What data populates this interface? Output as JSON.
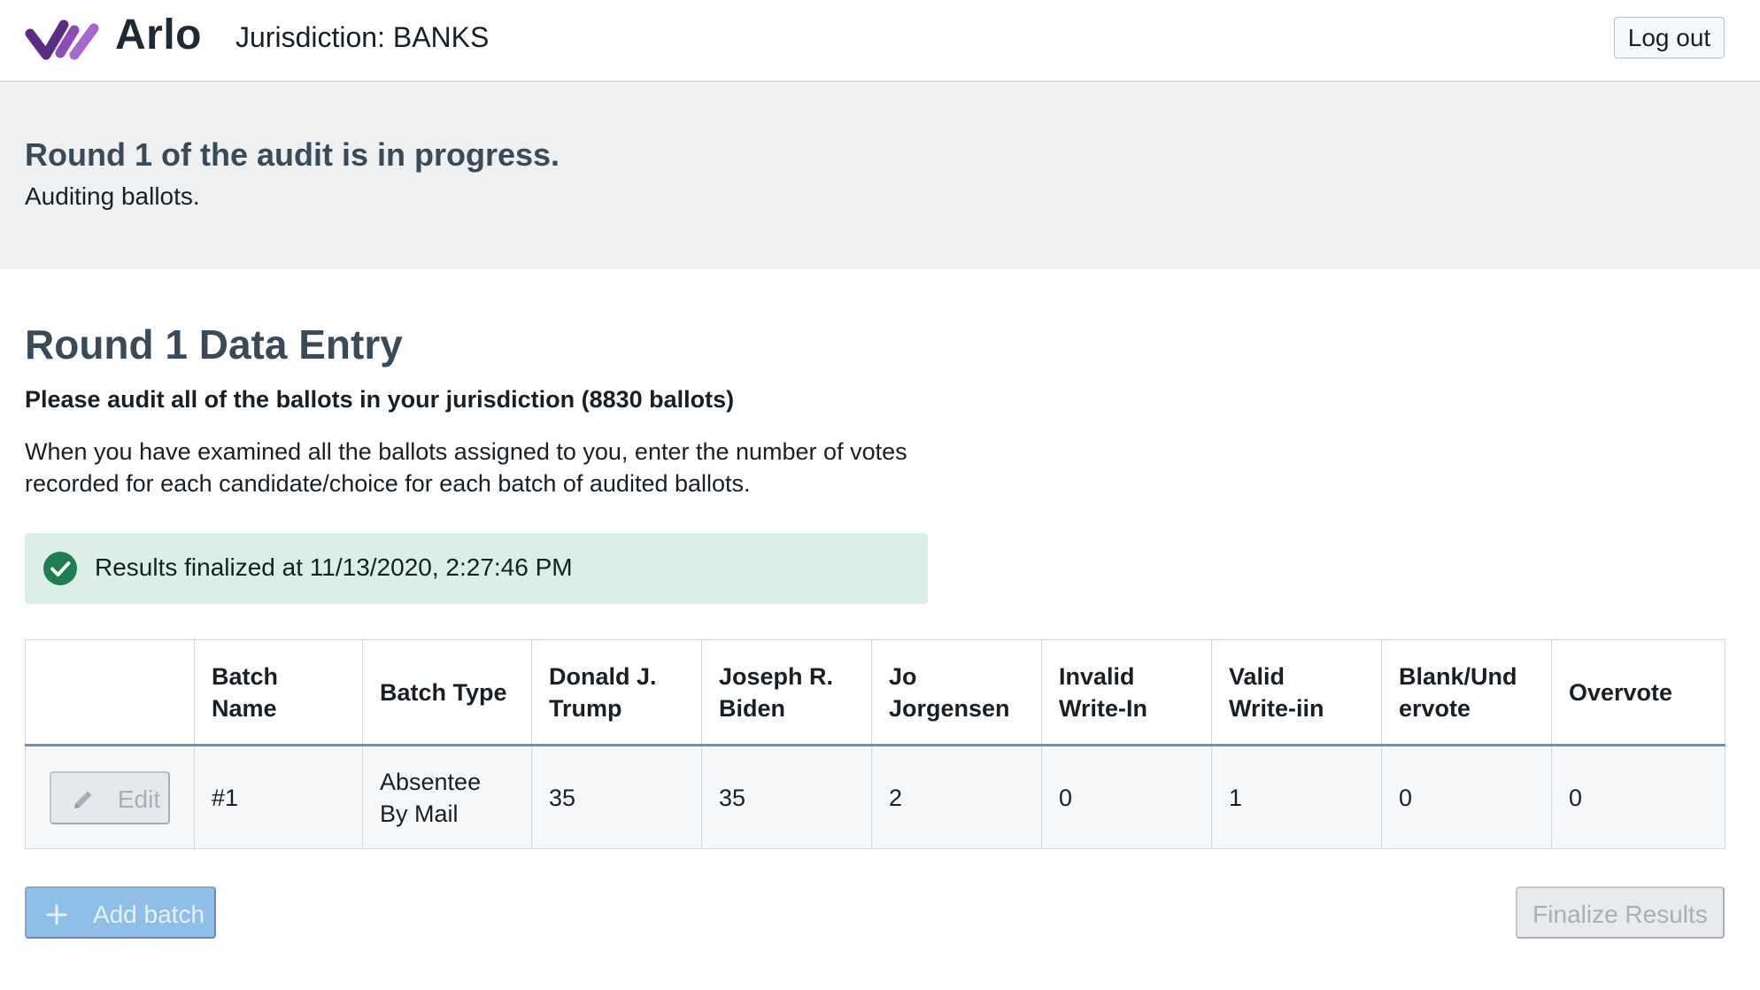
{
  "header": {
    "app_name": "Arlo",
    "jurisdiction": "Jurisdiction: BANKS",
    "logout_label": "Log out"
  },
  "status": {
    "title": "Round 1 of the audit is in progress.",
    "subtitle": "Auditing ballots."
  },
  "main": {
    "section_title": "Round 1 Data Entry",
    "instruction_bold": "Please audit all of the ballots in your jurisdiction (8830 ballots)",
    "instruction_text": "When you have examined all the ballots assigned to you, enter the number of votes recorded for each candidate/choice for each batch of audited ballots.",
    "callout": "Results finalized at 11/13/2020, 2:27:46 PM"
  },
  "table": {
    "columns": [
      "",
      "Batch Name",
      "Batch Type",
      "Donald J. Trump",
      "Joseph R. Biden",
      "Jo Jorgensen",
      "Invalid Write-In",
      "Valid Write-iin",
      "Blank/Undervote",
      "Overvote"
    ],
    "column_display": [
      "",
      "Batch\nName",
      "Batch Type",
      "Donald J.\nTrump",
      "Joseph R.\nBiden",
      "Jo\nJorgensen",
      "Invalid\nWrite-In",
      "Valid\nWrite-iin",
      "Blank/Und\nervote",
      "Overvote"
    ],
    "rows": [
      {
        "edit_label": "Edit",
        "batch_name": "#1",
        "batch_type": "Absentee By Mail",
        "trump": "35",
        "biden": "35",
        "jorgensen": "2",
        "invalid_write_in": "0",
        "valid_write_in": "1",
        "blank_undervote": "0",
        "overvote": "0"
      }
    ]
  },
  "actions": {
    "add_batch_label": "Add batch",
    "finalize_label": "Finalize Results"
  },
  "colors": {
    "brand_purple": "#7e3fa0",
    "success_green": "#1e7e4f",
    "primary_blue_disabled": "#8fbee8"
  }
}
